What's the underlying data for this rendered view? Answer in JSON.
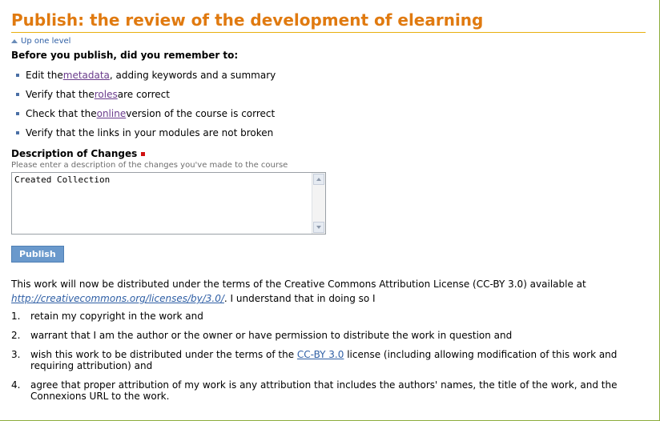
{
  "page": {
    "title": "Publish: the review of the development of elearning",
    "up_level": "Up one level",
    "intro": "Before you publish, did you remember to:"
  },
  "checklist": [
    {
      "before": "Edit the ",
      "link": "metadata",
      "after": ", adding keywords and a summary"
    },
    {
      "before": "Verify that the ",
      "link": "roles",
      "after": " are correct"
    },
    {
      "before": "Check that the ",
      "link": "online",
      "after": " version of the course is correct"
    },
    {
      "before": "Verify that the links in your modules are not broken",
      "link": "",
      "after": ""
    }
  ],
  "form": {
    "description_label": "Description of Changes",
    "description_help": "Please enter a description of the changes you've made to the course",
    "description_value": "Created Collection",
    "publish_label": "Publish"
  },
  "license": {
    "text_before": "This work will now be distributed under the terms of the Creative Commons Attribution License (CC-BY 3.0) available at ",
    "url": "http://creativecommons.org/licenses/by/3.0/",
    "text_after": ". I understand that in doing so I"
  },
  "terms": [
    {
      "num": "1.",
      "before": "retain my copyright in the work and",
      "link": "",
      "after": ""
    },
    {
      "num": "2.",
      "before": "warrant that I am the author or the owner or have permission to distribute the work in question and",
      "link": "",
      "after": ""
    },
    {
      "num": "3.",
      "before": "wish this work to be distributed under the terms of the ",
      "link": "CC-BY 3.0",
      "after": " license (including allowing modification of this work and requiring attribution) and"
    },
    {
      "num": "4.",
      "before": "agree that proper attribution of my work is any attribution that includes the authors' names, the title of the work, and the Connexions URL to the work.",
      "link": "",
      "after": ""
    }
  ],
  "colors": {
    "title": "#e07a10",
    "link": "#2f5fa5",
    "visited_link": "#6a3c8c",
    "button": "#6a99cc",
    "required": "#d01010"
  },
  "icons": {
    "up_level": "up-triangle-icon",
    "required": "required-marker-icon",
    "scroll_up": "scroll-up-arrow-icon",
    "scroll_down": "scroll-down-arrow-icon"
  }
}
